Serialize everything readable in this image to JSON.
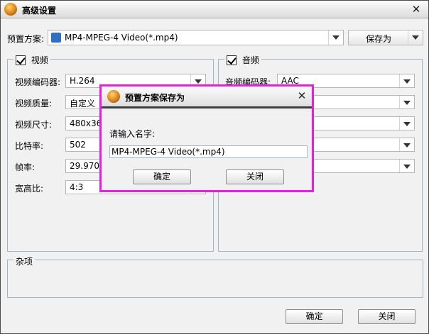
{
  "window": {
    "title": "高级设置"
  },
  "preset": {
    "label": "预置方案:",
    "value": "MP4-MPEG-4 Video(*.mp4)",
    "save_as_label": "保存为"
  },
  "video": {
    "legend": "视频",
    "rows": [
      {
        "label": "视频编码器:",
        "value": "H.264"
      },
      {
        "label": "视频质量:",
        "value": "自定义"
      },
      {
        "label": "视频尺寸:",
        "value": "480x360"
      },
      {
        "label": "比特率:",
        "value": "502"
      },
      {
        "label": "帧率:",
        "value": "29.970"
      },
      {
        "label": "宽高比:",
        "value": "4:3"
      }
    ]
  },
  "audio": {
    "legend": "音频",
    "rows": [
      {
        "label": "音频编码器:",
        "value": "AAC"
      }
    ]
  },
  "misc": {
    "legend": "杂项"
  },
  "footer": {
    "ok_label": "确定",
    "close_label": "关闭"
  },
  "dialog": {
    "title": "预置方案保存为",
    "prompt": "请输入名字:",
    "input_value": "MP4-MPEG-4 Video(*.mp4)",
    "ok_label": "确定",
    "close_label": "关闭"
  },
  "colors": {
    "highlight": "#e81fe1",
    "group_border": "#9fb6c9"
  }
}
